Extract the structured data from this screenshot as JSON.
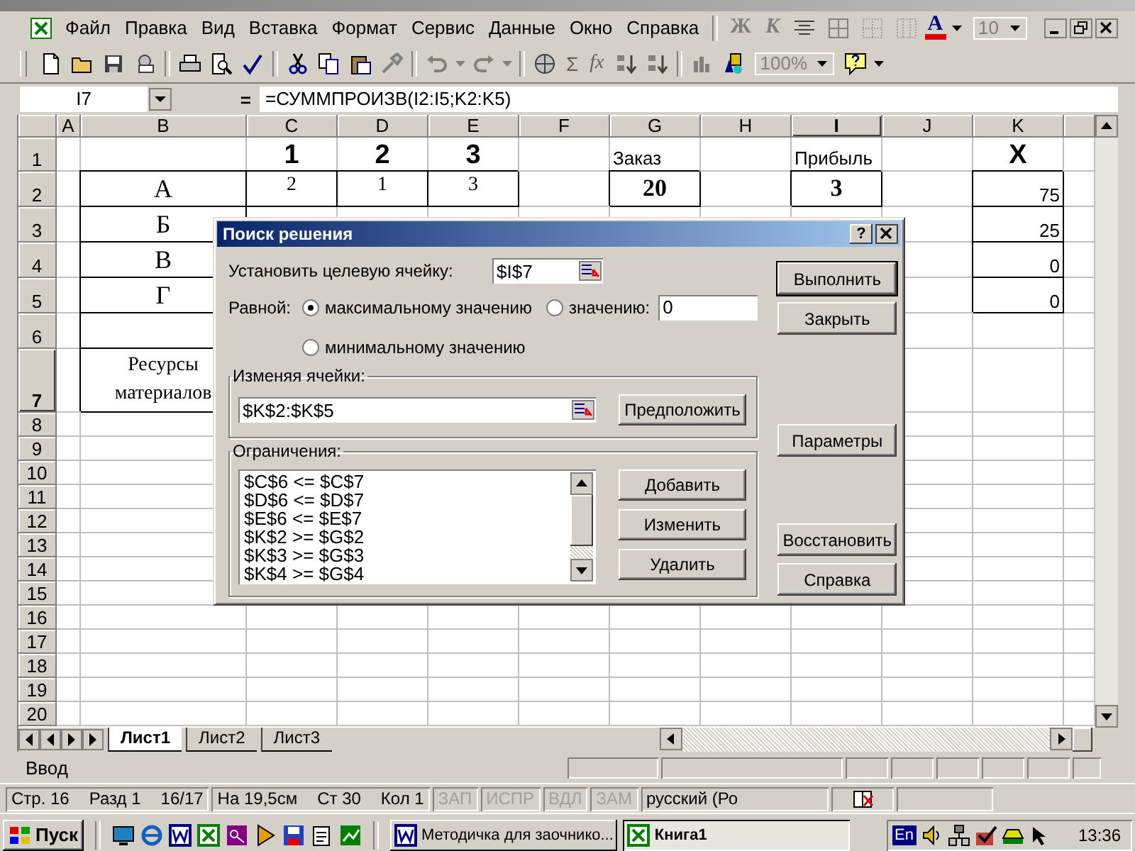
{
  "menu_bar": {
    "items": [
      "Файл",
      "Правка",
      "Вид",
      "Вставка",
      "Формат",
      "Сервис",
      "Данные",
      "Окно",
      "Справка"
    ],
    "bold": "Ж",
    "italic": "К",
    "font_color": "A",
    "font_size": "10"
  },
  "toolbar": {
    "sum": "Σ",
    "function": "fx",
    "zoom": "100%"
  },
  "formula_bar": {
    "name_box": "I7",
    "equals": "=",
    "formula": "=СУММПРОИЗВ(I2:I5;K2:K5)"
  },
  "sheet": {
    "columns": [
      {
        "label": "A",
        "selected": false
      },
      {
        "label": "B",
        "selected": false
      },
      {
        "label": "C",
        "selected": false
      },
      {
        "label": "D",
        "selected": false
      },
      {
        "label": "E",
        "selected": false
      },
      {
        "label": "F",
        "selected": false
      },
      {
        "label": "G",
        "selected": false
      },
      {
        "label": "H",
        "selected": false
      },
      {
        "label": "I",
        "selected": true
      },
      {
        "label": "J",
        "selected": false
      },
      {
        "label": "K",
        "selected": false
      }
    ],
    "rows": [
      {
        "label": "1",
        "selected": false,
        "cells": [
          {
            "boxed": false
          },
          {
            "boxed": false
          },
          {
            "text": "1",
            "kind": "heading",
            "boxed": false
          },
          {
            "text": "2",
            "kind": "heading",
            "boxed": false
          },
          {
            "text": "3",
            "kind": "heading",
            "boxed": false
          },
          {
            "boxed": false
          },
          {
            "text": "Заказ",
            "kind": "caption",
            "boxed": false
          },
          {
            "boxed": false
          },
          {
            "text": "Прибыль",
            "kind": "caption",
            "boxed": false
          },
          {
            "boxed": false
          },
          {
            "text": "X",
            "kind": "heading",
            "boxed": false
          }
        ]
      },
      {
        "label": "2",
        "selected": false,
        "cells": [
          {
            "boxed": false
          },
          {
            "text": "А",
            "kind": "label",
            "boxed": true
          },
          {
            "text": "2",
            "kind": "small",
            "boxed": true
          },
          {
            "text": "1",
            "kind": "small",
            "boxed": true
          },
          {
            "text": "3",
            "kind": "small",
            "boxed": true
          },
          {
            "boxed": false
          },
          {
            "text": "20",
            "kind": "bold_value",
            "boxed": true
          },
          {
            "boxed": false
          },
          {
            "text": "3",
            "kind": "bold_value",
            "boxed": true
          },
          {
            "boxed": false
          },
          {
            "text": "75",
            "kind": "number",
            "boxed": true
          }
        ]
      },
      {
        "label": "3",
        "selected": false,
        "cells": [
          {
            "boxed": false
          },
          {
            "text": "Б",
            "kind": "label",
            "boxed": true
          },
          {},
          {},
          {},
          {},
          {},
          {},
          {},
          {
            "boxed": false
          },
          {
            "text": "25",
            "kind": "number",
            "boxed": true
          }
        ]
      },
      {
        "label": "4",
        "selected": false,
        "cells": [
          {
            "boxed": false
          },
          {
            "text": "В",
            "kind": "label",
            "boxed": true
          },
          {},
          {},
          {},
          {},
          {},
          {},
          {},
          {
            "boxed": false
          },
          {
            "text": "0",
            "kind": "number",
            "boxed": true
          }
        ]
      },
      {
        "label": "5",
        "selected": false,
        "cells": [
          {
            "boxed": false
          },
          {
            "text": "Г",
            "kind": "label",
            "boxed": true
          },
          {},
          {},
          {},
          {},
          {},
          {},
          {},
          {
            "boxed": false
          },
          {
            "text": "0",
            "kind": "number",
            "boxed": true
          }
        ]
      },
      {
        "label": "6",
        "selected": false,
        "cells": [
          {
            "boxed": false
          },
          {
            "boxed": true
          },
          {},
          {},
          {},
          {},
          {},
          {},
          {},
          {
            "boxed": false
          },
          {
            "boxed": false
          }
        ]
      },
      {
        "label": "7",
        "selected": true,
        "cells": [
          {
            "boxed": false
          },
          {
            "text": "Ресурсы материалов",
            "kind": "wrapped",
            "boxed": true
          },
          {},
          {},
          {},
          {},
          {},
          {},
          {},
          {
            "boxed": false
          },
          {
            "boxed": false
          }
        ]
      },
      {
        "label": "8",
        "selected": false
      },
      {
        "label": "9",
        "selected": false
      },
      {
        "label": "10",
        "selected": false
      },
      {
        "label": "11",
        "selected": false
      },
      {
        "label": "12",
        "selected": false
      },
      {
        "label": "13",
        "selected": false
      },
      {
        "label": "14",
        "selected": false
      },
      {
        "label": "15",
        "selected": false
      },
      {
        "label": "16",
        "selected": false
      },
      {
        "label": "17",
        "selected": false
      },
      {
        "label": "18",
        "selected": false
      },
      {
        "label": "19",
        "selected": false
      },
      {
        "label": "20",
        "selected": false
      }
    ]
  },
  "dialog": {
    "title": "Поиск решения",
    "help": "?",
    "target_label": "Установить целевую ячейку:",
    "target": "$I$7",
    "equal_label": "Равной:",
    "options": [
      {
        "label": "максимальному значению",
        "selected": true
      },
      {
        "label": "значению:",
        "selected": false
      },
      {
        "label": "минимальному значению",
        "selected": false
      }
    ],
    "value": "0",
    "changing_label": "Изменяя ячейки:",
    "changing": "$K$2:$K$5",
    "guess": "Предположить",
    "constraints_label": "Ограничения:",
    "constraints": [
      "$C$6 <= $C$7",
      "$D$6 <= $D$7",
      "$E$6 <= $E$7",
      "$K$2 >= $G$2",
      "$K$3 >= $G$3",
      "$K$4 >= $G$4"
    ],
    "constraint_buttons": [
      "Добавить",
      "Изменить",
      "Удалить"
    ],
    "buttons": [
      {
        "label": "Выполнить",
        "default": true
      },
      {
        "label": "Закрыть",
        "default": false
      },
      {
        "label": "Параметры",
        "default": false
      },
      {
        "label": "Восстановить",
        "default": false
      },
      {
        "label": "Справка",
        "default": false
      }
    ]
  },
  "sheet_tabs": [
    {
      "label": "Лист1",
      "selected": true
    },
    {
      "label": "Лист2",
      "selected": false
    },
    {
      "label": "Лист3",
      "selected": false
    }
  ],
  "status": "Ввод",
  "word_status": {
    "page": "Стр. 16",
    "section": "Разд 1",
    "pages": "16/17",
    "position": "На 19,5см",
    "line": "Ст 30",
    "column": "Кол 1",
    "modes": [
      {
        "label": "ЗАП",
        "disabled": true
      },
      {
        "label": "ИСПР",
        "disabled": true
      },
      {
        "label": "ВДЛ",
        "disabled": true
      },
      {
        "label": "ЗАМ",
        "disabled": true
      }
    ],
    "language": "русский (Ро"
  },
  "taskbar": {
    "start": "Пуск",
    "tasks": [
      {
        "label": "Методичка для заочнико...",
        "selected": false
      },
      {
        "label": "Книга1",
        "selected": true
      }
    ],
    "language": "En",
    "clock": "13:36"
  }
}
